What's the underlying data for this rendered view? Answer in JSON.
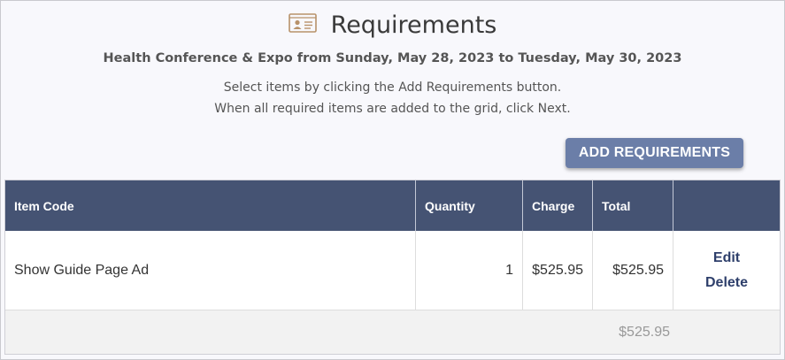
{
  "page": {
    "title": "Requirements",
    "icon": "id-card-icon",
    "subtitle": "Health Conference & Expo from Sunday, May 28, 2023 to Tuesday, May 30, 2023",
    "instruction_line1": "Select items by clicking the Add Requirements button.",
    "instruction_line2": "When all required items are added to the grid, click Next."
  },
  "toolbar": {
    "add_label": "ADD REQUIREMENTS"
  },
  "grid": {
    "columns": [
      "Item Code",
      "Quantity",
      "Charge",
      "Total",
      ""
    ],
    "rows": [
      {
        "item_code": "Show Guide Page Ad",
        "quantity": "1",
        "charge": "$525.95",
        "total": "$525.95",
        "edit_label": "Edit",
        "delete_label": "Delete"
      }
    ],
    "footer_total": "$525.95"
  },
  "colors": {
    "header_bg": "#455373",
    "button_bg": "#6b7ea8",
    "link": "#2e3f6b",
    "icon": "#b8926a"
  }
}
